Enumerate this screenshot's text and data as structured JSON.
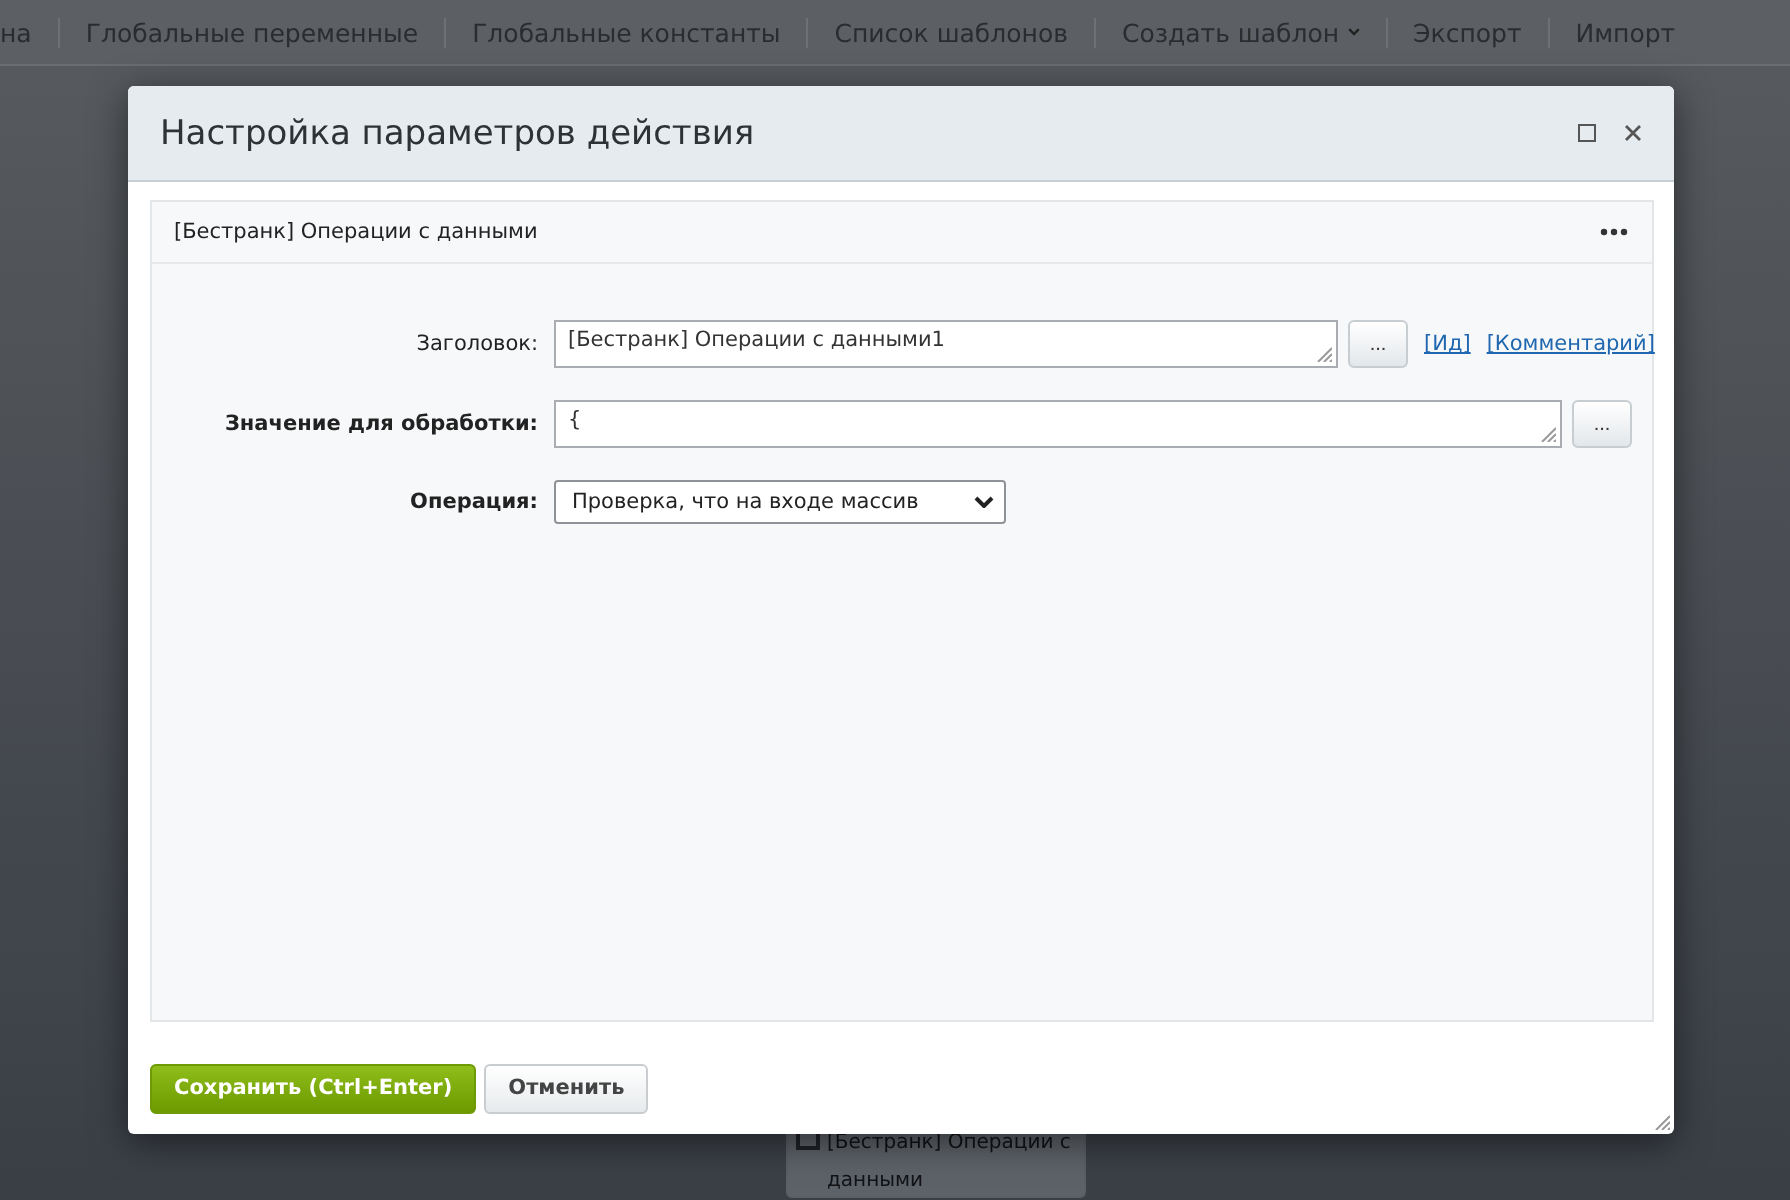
{
  "top_nav": {
    "items": [
      {
        "label": "на"
      },
      {
        "label": "Глобальные переменные"
      },
      {
        "label": "Глобальные константы"
      },
      {
        "label": "Список шаблонов"
      },
      {
        "label": "Создать шаблон",
        "dropdown": true
      },
      {
        "label": "Экспорт"
      },
      {
        "label": "Импорт"
      }
    ]
  },
  "background_node": {
    "lines": [
      "[Бестранк] Операции с",
      "данными"
    ]
  },
  "dialog": {
    "title": "Настройка параметров действия",
    "panel": {
      "title": "[Бестранк] Операции с данными",
      "fields": [
        {
          "kind": "text",
          "label": "Заголовок:",
          "value": "[Бестранк] Операции с данными1",
          "button": "...",
          "links": [
            "[Ид]",
            "[Комментарий]"
          ]
        },
        {
          "kind": "textarea",
          "label": "Значение для обработки:",
          "value": "{",
          "button": "..."
        },
        {
          "kind": "select",
          "label": "Операция:",
          "value": "Проверка, что на входе массив"
        }
      ]
    },
    "buttons": [
      {
        "label": "Сохранить (Ctrl+Enter)",
        "kind": "primary"
      },
      {
        "label": "Отменить",
        "kind": "secondary"
      }
    ]
  }
}
